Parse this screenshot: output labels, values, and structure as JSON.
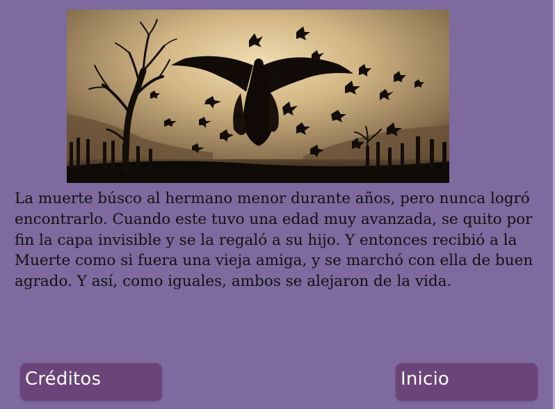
{
  "hero_image": {
    "description_name": "illustration"
  },
  "story": {
    "text": "La muerte búsco al hermano menor durante años, pero nunca logró encontrarlo. Cuando este tuvo una edad muy avanzada, se quito por fin la capa invisible y se la regaló a su hijo. Y entonces recibió a la Muerte como si fuera una vieja amiga, y se marchó con ella de buen agrado. Y así, como iguales, ambos se alejaron de la vida."
  },
  "buttons": {
    "credits_label": "Créditos",
    "home_label": "Inicio"
  },
  "colors": {
    "background": "#7e6a9e",
    "button": "#6b4479",
    "button_text": "#ffffff",
    "text": "#111111"
  }
}
